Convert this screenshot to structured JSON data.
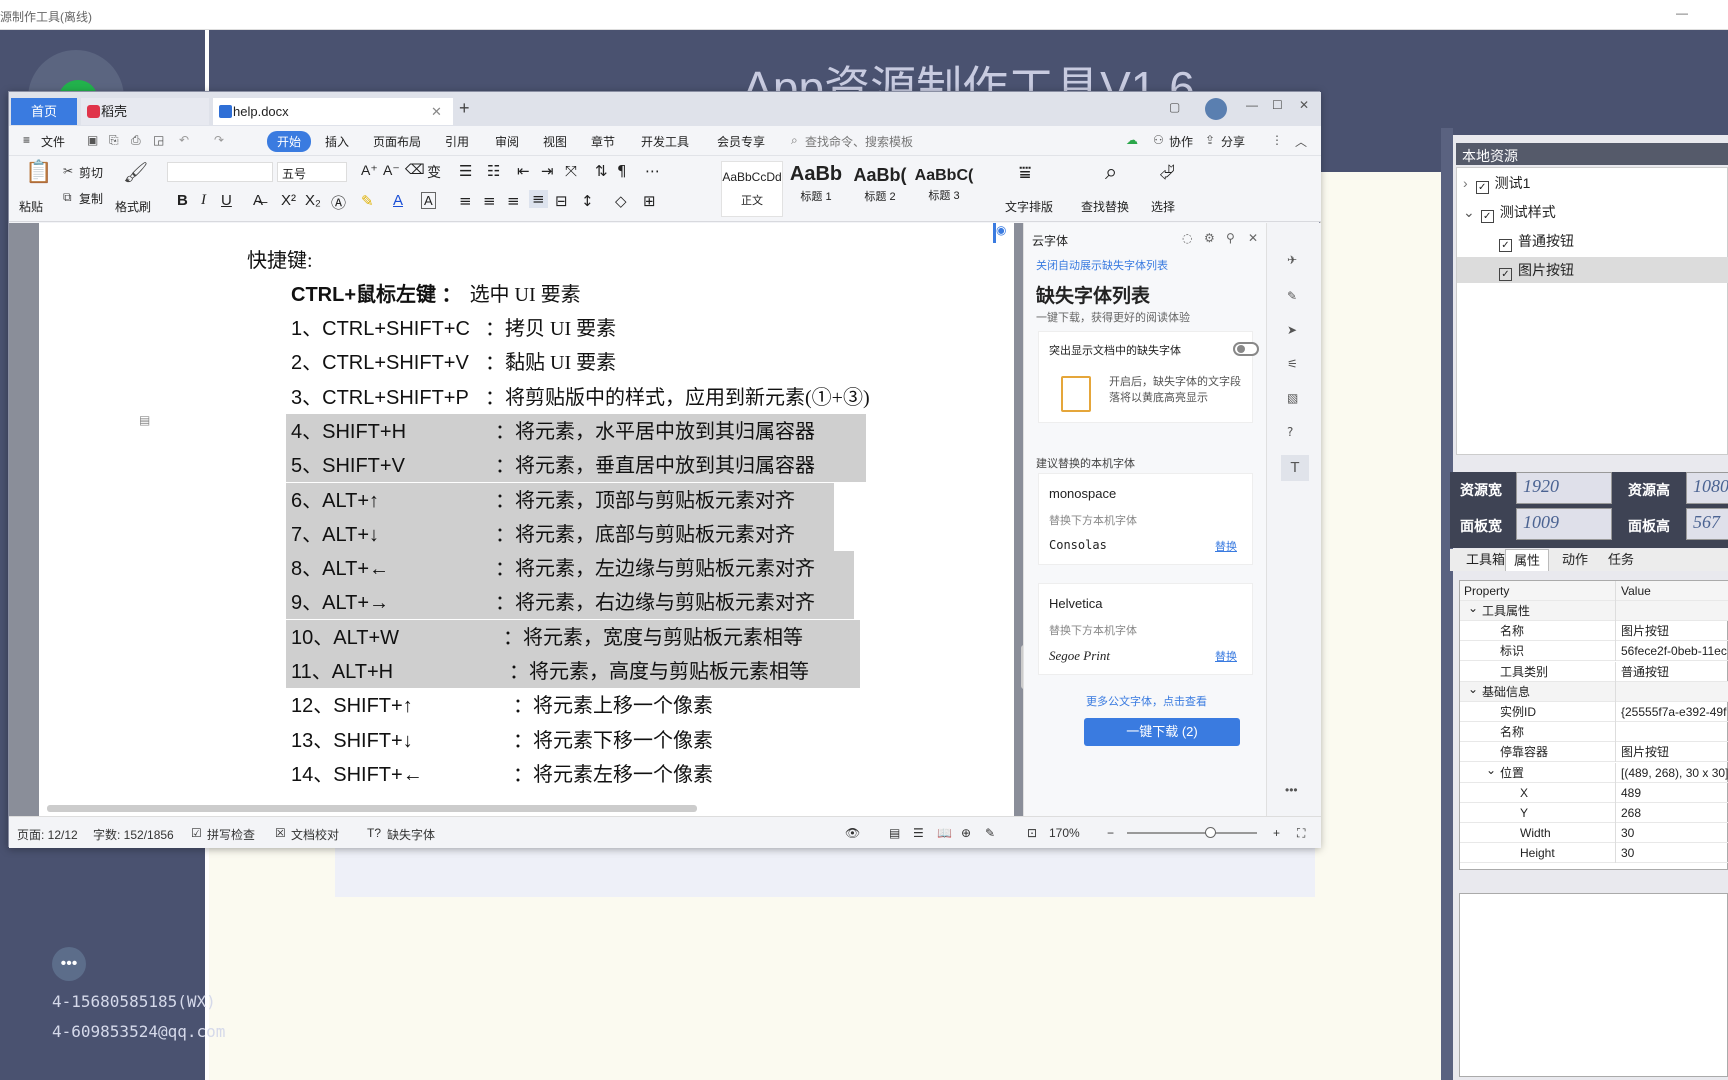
{
  "bg": {
    "window_title": "源制作工具(离线)",
    "header": "App资源制作工具V1.6",
    "contact_wx": "4-15680585185(WX)",
    "contact_qq": "4-609853524@qq.com"
  },
  "right_panel": {
    "title": "本地资源",
    "tree": [
      {
        "label": "测试1",
        "level": 0,
        "expanded": false,
        "checked": true
      },
      {
        "label": "测试样式",
        "level": 0,
        "expanded": true,
        "checked": true
      },
      {
        "label": "普通按钮",
        "level": 1,
        "checked": true
      },
      {
        "label": "图片按钮",
        "level": 1,
        "checked": true,
        "selected": true
      }
    ],
    "res_w_label": "资源宽",
    "res_w": "1920",
    "res_h_label": "资源高",
    "res_h": "1080",
    "panel_w_label": "面板宽",
    "panel_w": "1009",
    "panel_h_label": "面板高",
    "panel_h": "567",
    "tabs": [
      "工具箱",
      "属性",
      "动作",
      "任务"
    ],
    "active_tab": "属性",
    "table_header": {
      "property": "Property",
      "value": "Value"
    },
    "rows": [
      {
        "k": "工具属性",
        "v": "",
        "group": true
      },
      {
        "k": "名称",
        "v": "图片按钮"
      },
      {
        "k": "标识",
        "v": "56fece2f-0beb-11ec"
      },
      {
        "k": "工具类别",
        "v": "普通按钮"
      },
      {
        "k": "基础信息",
        "v": "",
        "group": true
      },
      {
        "k": "实例ID",
        "v": "{25555f7a-e392-49f"
      },
      {
        "k": "名称",
        "v": ""
      },
      {
        "k": "停靠容器",
        "v": "图片按钮"
      },
      {
        "k": "位置",
        "v": "[(489, 268), 30 x 30]",
        "group2": true
      },
      {
        "k": "X",
        "v": "489",
        "sub": true
      },
      {
        "k": "Y",
        "v": "268",
        "sub": true
      },
      {
        "k": "Width",
        "v": "30",
        "sub": true
      },
      {
        "k": "Height",
        "v": "30",
        "sub": true
      }
    ]
  },
  "wps": {
    "tabs": {
      "home": "首页",
      "daoke": "稻壳",
      "doc": "help.docx"
    },
    "menu": [
      "文件",
      "开始",
      "插入",
      "页面布局",
      "引用",
      "审阅",
      "视图",
      "章节",
      "开发工具",
      "会员专享"
    ],
    "search_placeholder": "查找命令、搜索模板",
    "collab": "协作",
    "share": "分享",
    "ribbon": {
      "paste": "粘贴",
      "cut": "剪切",
      "copy": "复制",
      "format_painter": "格式刷",
      "font_size": "五号",
      "styles": [
        {
          "sample": "AaBbCcDd",
          "name": "正文"
        },
        {
          "sample": "AaBb",
          "name": "标题 1"
        },
        {
          "sample": "AaBb(",
          "name": "标题 2"
        },
        {
          "sample": "AaBbC(",
          "name": "标题 3"
        }
      ],
      "text_layout": "文字排版",
      "find_replace": "查找替换",
      "select": "选择"
    },
    "doc": {
      "heading": "快捷键:",
      "bold_line": {
        "k": "CTRL+鼠标左键 ：",
        "v": "选中 UI 要素"
      },
      "lines": [
        {
          "k": "1、CTRL+SHIFT+C",
          "v": "：拷贝 UI 要素",
          "hl": false
        },
        {
          "k": "2、CTRL+SHIFT+V",
          "v": "：黏贴 UI 要素",
          "hl": false
        },
        {
          "k": "3、CTRL+SHIFT+P",
          "v": "：将剪贴版中的样式，应用到新元素(①+③)",
          "hl": false
        },
        {
          "k": "4、SHIFT+H",
          "v": "：将元素，水平居中放到其归属容器",
          "hl": true
        },
        {
          "k": "5、SHIFT+V",
          "v": "：将元素，垂直居中放到其归属容器",
          "hl": true
        },
        {
          "k": "6、ALT+↑",
          "v": "：将元素，顶部与剪贴板元素对齐",
          "hl": true
        },
        {
          "k": "7、ALT+↓",
          "v": "：将元素，底部与剪贴板元素对齐",
          "hl": true
        },
        {
          "k": "8、ALT+←",
          "v": "：将元素，左边缘与剪贴板元素对齐",
          "hl": true
        },
        {
          "k": "9、ALT+→",
          "v": "：将元素，右边缘与剪贴板元素对齐",
          "hl": true
        },
        {
          "k": "10、ALT+W",
          "v": "：将元素，宽度与剪贴板元素相等",
          "hl": true
        },
        {
          "k": "11、ALT+H",
          "v": "：将元素，高度与剪贴板元素相等",
          "hl": true
        },
        {
          "k": "12、SHIFT+↑",
          "v": "：将元素上移一个像素",
          "hl": false
        },
        {
          "k": "13、SHIFT+↓",
          "v": "：将元素下移一个像素",
          "hl": false
        },
        {
          "k": "14、SHIFT+←",
          "v": "：将元素左移一个像素",
          "hl": false
        }
      ]
    },
    "side": {
      "font_menu": "云字体",
      "auto_close": "关闭自动展示缺失字体列表",
      "title": "缺失字体列表",
      "subtitle": "一键下载，获得更好的阅读体验",
      "highlight_label": "突出显示文档中的缺失字体",
      "highlight_desc": "开启后，缺失字体的文字段落将以黄底高亮显示",
      "suggest": "建议替换的本机字体",
      "fonts": [
        {
          "missing": "monospace",
          "hint": "替换下方本机字体",
          "local": "Consolas",
          "action": "替换"
        },
        {
          "missing": "Helvetica",
          "hint": "替换下方本机字体",
          "local": "Segoe Print",
          "action": "替换"
        }
      ],
      "more": "更多公文字体，点击查看",
      "download": "一键下载 (2)"
    },
    "status": {
      "page": "页面: 12/12",
      "words": "字数: 152/1856",
      "spell": "拼写检查",
      "proof": "文档校对",
      "missing_font": "缺失字体",
      "zoom": "170%"
    }
  },
  "colors": {
    "accent": "#3a7be0",
    "bg_dark": "#4a5270"
  }
}
